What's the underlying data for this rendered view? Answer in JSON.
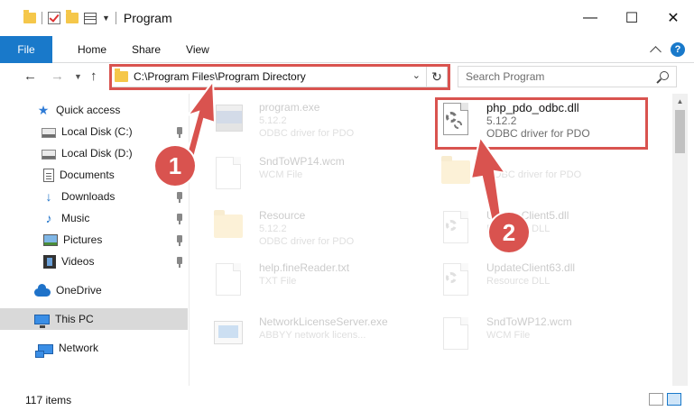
{
  "window": {
    "title": "Program",
    "minimize": "—",
    "maximize": "☐",
    "close": "✕"
  },
  "ribbon": {
    "tabs": [
      "File",
      "Home",
      "Share",
      "View"
    ]
  },
  "address": {
    "path": "C:\\Program Files\\Program Directory",
    "search_placeholder": "Search Program"
  },
  "nav": {
    "back": "←",
    "forward": "→",
    "up": "↑"
  },
  "sidebar": {
    "items": [
      {
        "label": "Quick access",
        "icon": "star-icon"
      },
      {
        "label": "Local Disk (C:)",
        "icon": "disk-icon"
      },
      {
        "label": "Local Disk (D:)",
        "icon": "disk-icon"
      },
      {
        "label": "Documents",
        "icon": "documents-icon"
      },
      {
        "label": "Downloads",
        "icon": "download-icon"
      },
      {
        "label": "Music",
        "icon": "music-icon"
      },
      {
        "label": "Pictures",
        "icon": "pictures-icon"
      },
      {
        "label": "Videos",
        "icon": "videos-icon"
      },
      {
        "label": "OneDrive",
        "icon": "onedrive-icon"
      },
      {
        "label": "This PC",
        "icon": "pc-icon"
      },
      {
        "label": "Network",
        "icon": "network-icon"
      }
    ]
  },
  "files": [
    {
      "name": "program.exe",
      "sub1": "5.12.2",
      "sub2": "ODBC driver for PDO"
    },
    {
      "name": "php_pdo_odbc.dll",
      "sub1": "5.12.2",
      "sub2": "ODBC driver for PDO"
    },
    {
      "name": "SndToWP14.wcm",
      "sub1": "WCM File",
      "sub2": ""
    },
    {
      "name": "",
      "sub1": "ODBC driver for PDO",
      "sub2": ""
    },
    {
      "name": "Resource",
      "sub1": "5.12.2",
      "sub2": "ODBC driver for PDO"
    },
    {
      "name": "UpdateClient5.dll",
      "sub1": "Resource DLL",
      "sub2": ""
    },
    {
      "name": "help.fineReader.txt",
      "sub1": "TXT File",
      "sub2": ""
    },
    {
      "name": "UpdateClient63.dll",
      "sub1": "Resource DLL",
      "sub2": ""
    },
    {
      "name": "NetworkLicenseServer.exe",
      "sub1": "ABBYY network licens...",
      "sub2": ""
    },
    {
      "name": "SndToWP12.wcm",
      "sub1": "WCM File",
      "sub2": ""
    }
  ],
  "status": {
    "item_count": "117 items"
  },
  "annotations": {
    "step1": "1",
    "step2": "2",
    "color": "#d9534f"
  }
}
